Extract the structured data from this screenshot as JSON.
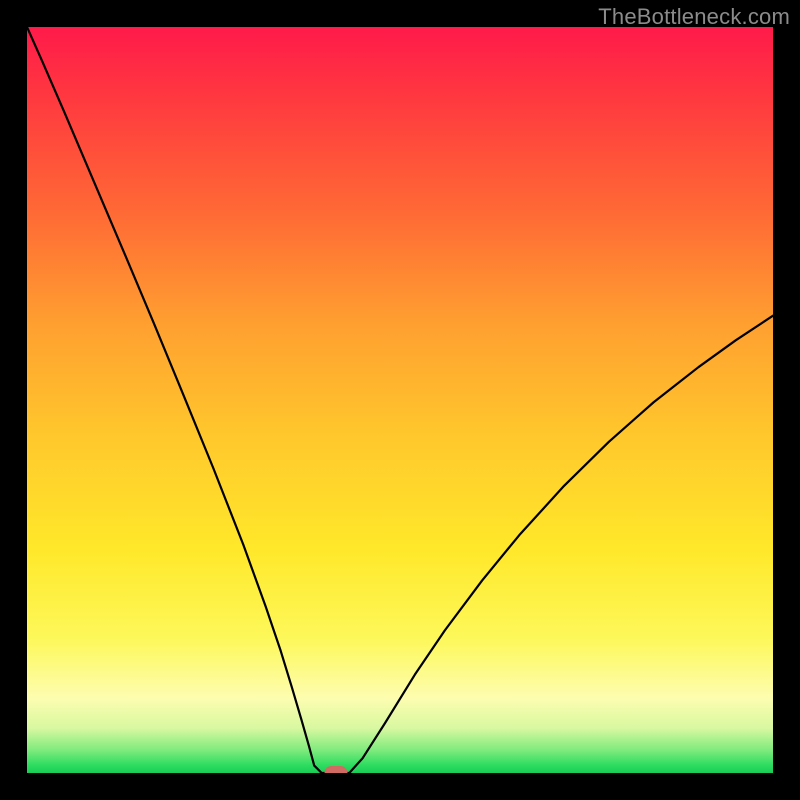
{
  "watermark": "TheBottleneck.com",
  "chart_data": {
    "type": "line",
    "title": "",
    "xlabel": "",
    "ylabel": "",
    "xlim": [
      0,
      100
    ],
    "ylim": [
      0,
      100
    ],
    "x": [
      0,
      2,
      5,
      9,
      13,
      17,
      21,
      25,
      29,
      32,
      34,
      35.5,
      36.8,
      37.8,
      38.5,
      39.5,
      43.2,
      45,
      48,
      52,
      56,
      61,
      66,
      72,
      78,
      84,
      90,
      95,
      100
    ],
    "values": [
      100,
      95.5,
      88.6,
      79.2,
      69.8,
      60.3,
      50.6,
      40.8,
      30.6,
      22.3,
      16.4,
      11.5,
      7.1,
      3.6,
      1.0,
      0.0,
      0.0,
      2.0,
      6.7,
      13.2,
      19.1,
      25.8,
      31.9,
      38.5,
      44.4,
      49.7,
      54.4,
      58.0,
      61.3
    ],
    "marker": {
      "x": 41.4,
      "y": 0.0
    },
    "background_gradient": {
      "top": "#ff1a4a",
      "mid": "#ffe82a",
      "bottom": "#1acc55"
    }
  }
}
